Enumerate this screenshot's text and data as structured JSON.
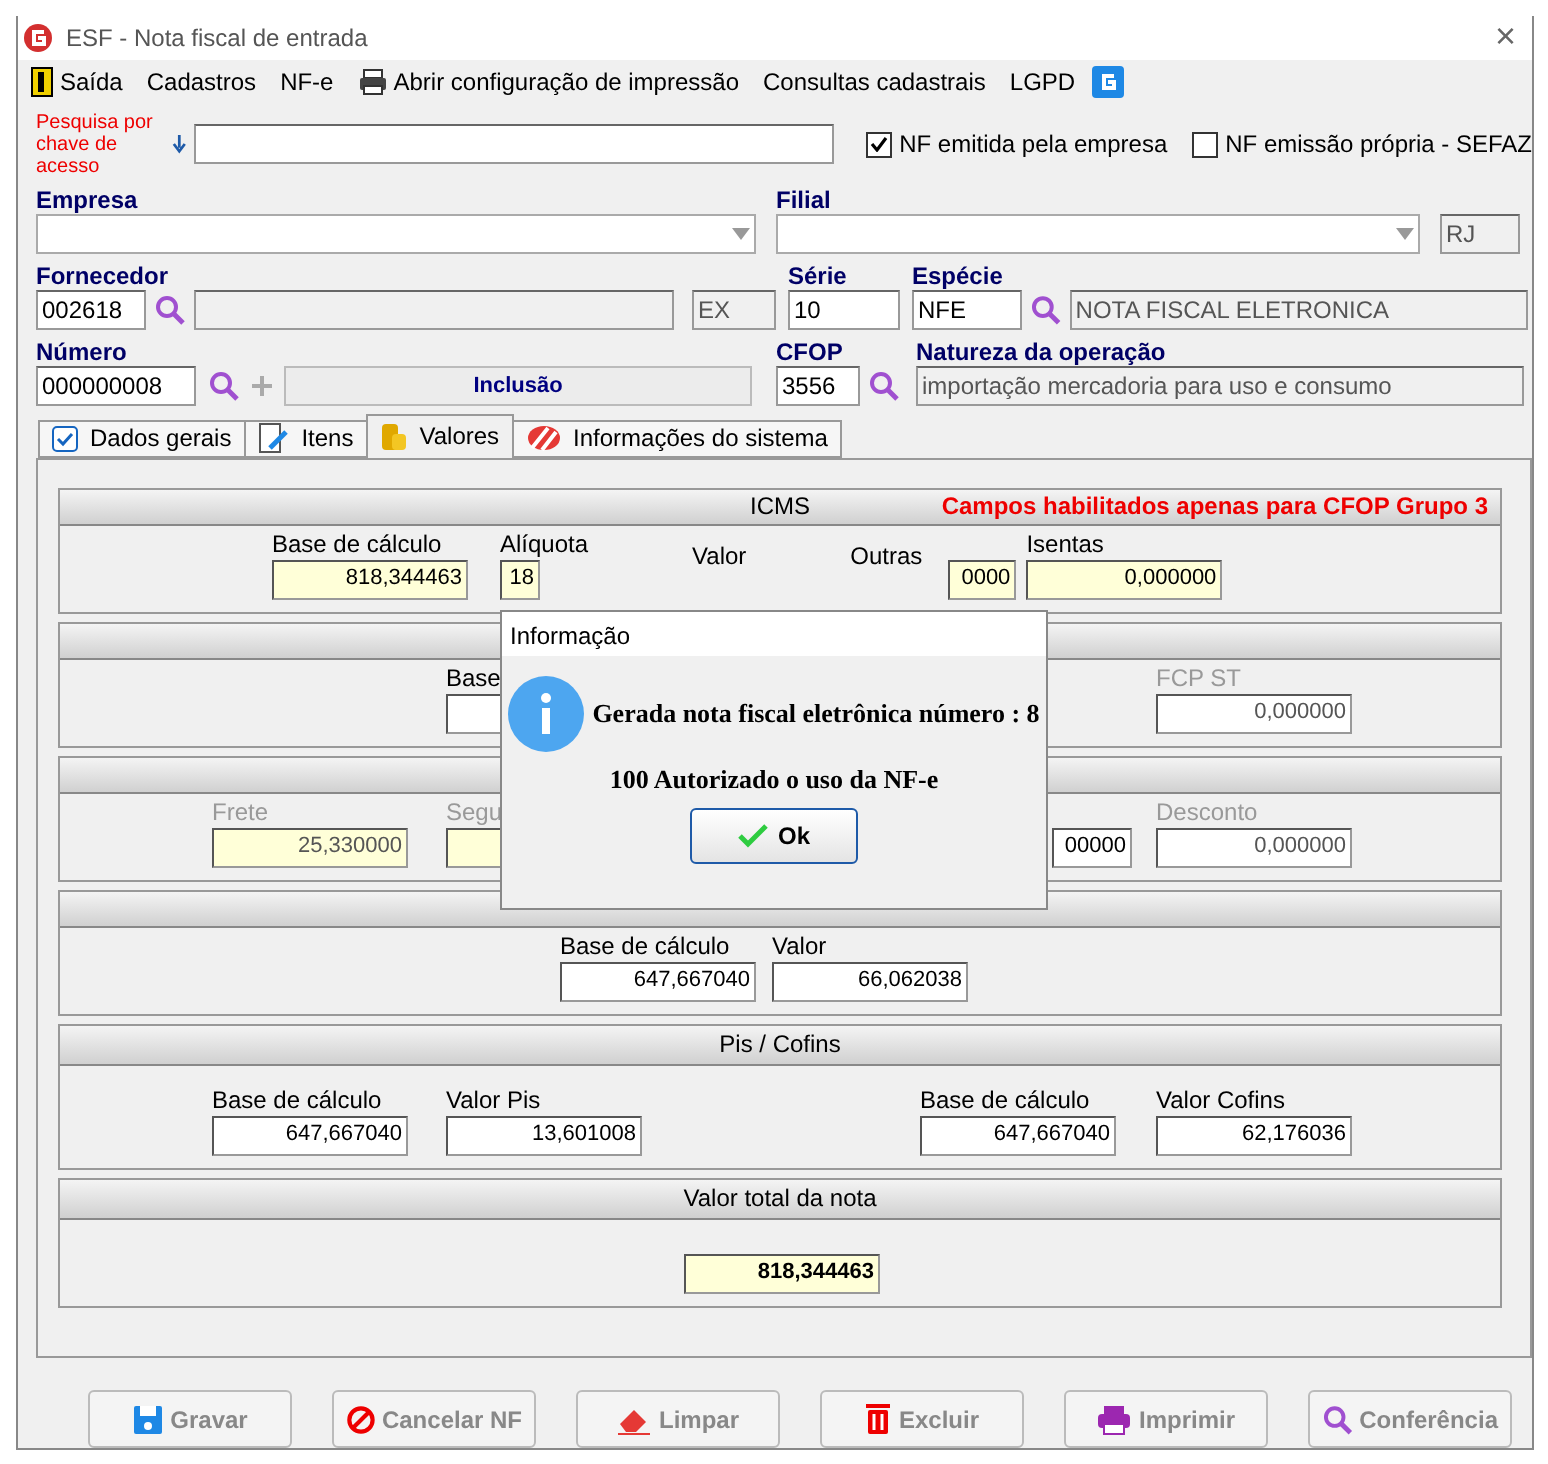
{
  "window": {
    "title": "ESF - Nota fiscal de entrada",
    "close": "×"
  },
  "menu": [
    "Saída",
    "Cadastros",
    "NF-e",
    "Abrir configuração de impressão",
    "Consultas cadastrais",
    "LGPD"
  ],
  "search": {
    "label": "Pesquisa por chave de acesso"
  },
  "checkboxes": [
    {
      "label": "NF emitida pela empresa",
      "checked": true
    },
    {
      "label": "NF emissão própria - SEFAZ",
      "checked": false
    }
  ],
  "form": {
    "empresa": {
      "label": "Empresa"
    },
    "filial": {
      "label": "Filial",
      "uf": "RJ"
    },
    "fornecedor": {
      "label": "Fornecedor",
      "code": "002618",
      "uf": "EX"
    },
    "serie": {
      "label": "Série",
      "value": "10"
    },
    "especie": {
      "label": "Espécie",
      "value": "NFE",
      "description": "NOTA FISCAL ELETRONICA"
    },
    "numero": {
      "label": "Número",
      "value": "000000008",
      "status": "Inclusão"
    },
    "cfop": {
      "label": "CFOP",
      "value": "3556"
    },
    "natureza": {
      "label": "Natureza da operação",
      "value": "importação mercadoria para uso e consumo"
    }
  },
  "tabs": [
    {
      "label": "Dados gerais",
      "selected": false
    },
    {
      "label": "Itens",
      "selected": false
    },
    {
      "label": "Valores",
      "selected": true
    },
    {
      "label": "Informações do sistema",
      "selected": false
    }
  ],
  "panels": [
    {
      "title": "ICMS",
      "note": "Campos habilitados apenas para CFOP Grupo 3",
      "fields": [
        {
          "label": "Base de cálculo",
          "value": "818,344463",
          "kind": "field",
          "highlight": true
        },
        {
          "label": "Alíquota",
          "value": "18",
          "kind": "field",
          "highlight": true
        },
        {
          "label": "Valor",
          "kind": "label"
        },
        {
          "label": "Outras",
          "kind": "label"
        },
        {
          "value": "0000",
          "kind": "field",
          "highlight": true
        },
        {
          "label": "Isentas",
          "value": "0,000000",
          "kind": "field",
          "highlight": true
        }
      ]
    },
    {
      "fields": [
        {
          "label": "Base",
          "kind": "field"
        },
        {
          "label": "FCP ST",
          "value": "0,000000",
          "kind": "field",
          "disabled": true
        }
      ]
    },
    {
      "fields": [
        {
          "label": "Frete",
          "value": "25,330000",
          "kind": "field",
          "highlight": true,
          "disabled": true
        },
        {
          "label": "Segu",
          "kind": "field",
          "highlight": true,
          "disabled": true
        },
        {
          "value": "00000",
          "kind": "field"
        },
        {
          "label": "Desconto",
          "value": "0,000000",
          "kind": "field",
          "disabled": true
        }
      ]
    },
    {
      "fields": [
        {
          "label": "Base de cálculo",
          "value": "647,667040",
          "kind": "field"
        },
        {
          "label": "Valor",
          "value": "66,062038",
          "kind": "field"
        }
      ]
    },
    {
      "title": "Pis / Cofins",
      "fields": [
        {
          "label": "Base de cálculo",
          "value": "647,667040",
          "kind": "field"
        },
        {
          "label": "Valor Pis",
          "value": "13,601008",
          "kind": "field"
        },
        {
          "label": "Base de cálculo",
          "value": "647,667040",
          "kind": "field"
        },
        {
          "label": "Valor Cofins",
          "value": "62,176036",
          "kind": "field"
        }
      ]
    },
    {
      "title": "Valor total da nota",
      "fields": [
        {
          "value": "818,344463",
          "kind": "field",
          "highlight": true,
          "bold": true
        }
      ]
    }
  ],
  "dialog": {
    "title": "Informação",
    "lines": [
      "Gerada nota fiscal eletrônica número : 8",
      "100 Autorizado o uso da NF-e"
    ],
    "button": "Ok"
  },
  "buttons": [
    {
      "label": "Gravar",
      "disabled": true
    },
    {
      "label": "Cancelar NF",
      "disabled": true
    },
    {
      "label": "Limpar",
      "disabled": true
    },
    {
      "label": "Excluir",
      "disabled": true
    },
    {
      "label": "Imprimir",
      "disabled": true
    },
    {
      "label": "Conferência",
      "disabled": true
    }
  ]
}
